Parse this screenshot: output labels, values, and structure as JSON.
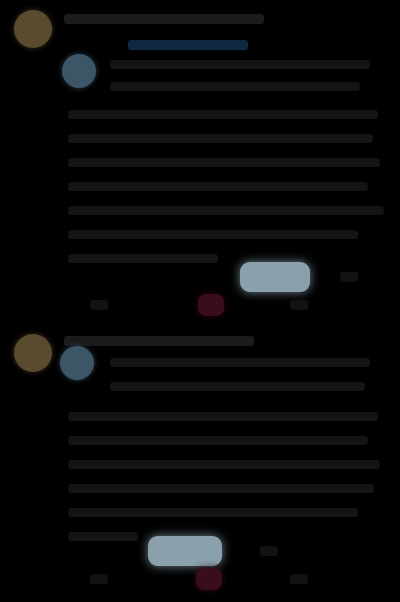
{
  "feed": {
    "posts": [
      {
        "author": "",
        "handle": "",
        "text": "",
        "action_label": "",
        "like_count": ""
      },
      {
        "author": "",
        "handle": "",
        "text": "",
        "action_label": "",
        "like_count": ""
      }
    ]
  },
  "colors": {
    "background": "#000000",
    "accent_pill": "#8aa0ab",
    "like": "#3a0d1d",
    "link": "#0f2942"
  }
}
